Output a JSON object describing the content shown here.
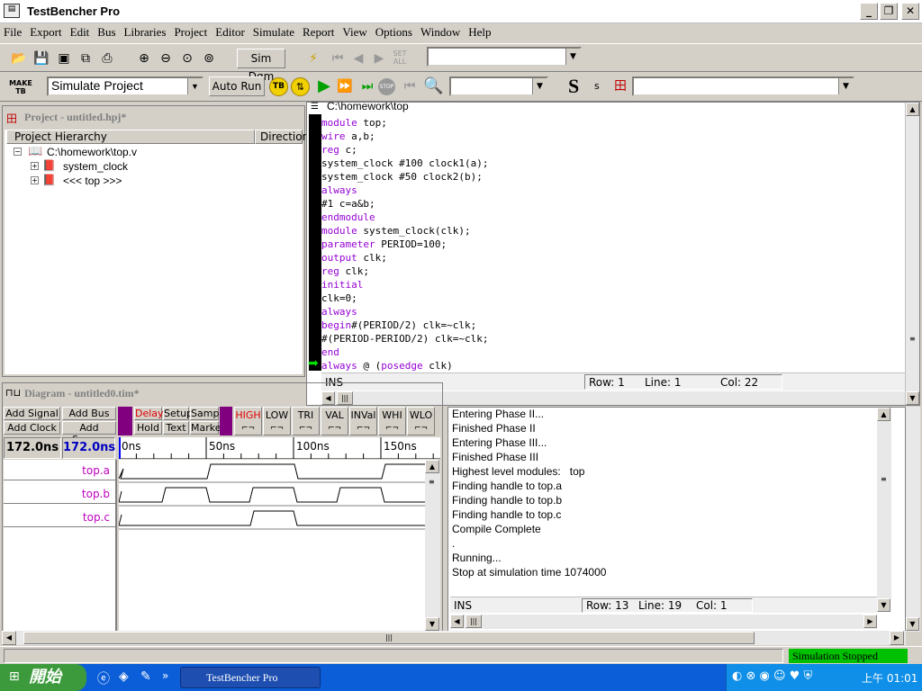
{
  "app": {
    "title": "TestBencher Pro"
  },
  "menu": [
    "File",
    "Export",
    "Edit",
    "Bus",
    "Libraries",
    "Project",
    "Editor",
    "Simulate",
    "Report",
    "View",
    "Options",
    "Window",
    "Help"
  ],
  "toolbar": {
    "sim_dgm": "Sim Dgm",
    "set_all": "SET ALL",
    "make_tb": "MAKE TB",
    "simulate_project": "Simulate Project",
    "auto_run": "Auto Run",
    "tb": "TB",
    "stop": "STOP",
    "s_big": "S",
    "s_small": "s"
  },
  "project": {
    "title": "Project - untitled.hpj*",
    "col_hierarchy": "Project Hierarchy",
    "col_direction": "Direction",
    "root": "C:\\homework\\top.v",
    "children": [
      "system_clock",
      "<<< top >>>"
    ]
  },
  "editor": {
    "title": "C:\\homework\\top",
    "lines": [
      "module top;",
      "wire a,b;",
      "reg c;",
      "system_clock #100 clock1(a);",
      "system_clock #50 clock2(b);",
      "always",
      "#1 c=a&b;",
      "endmodule",
      "module system_clock(clk);",
      "parameter PERIOD=100;",
      "output clk;",
      "reg clk;",
      "initial",
      "clk=0;",
      "always",
      "begin#(PERIOD/2) clk=~clk;",
      "#(PERIOD-PERIOD/2) clk=~clk;",
      "end",
      "always @ (posedge clk)"
    ],
    "keywords": [
      "module",
      "wire",
      "reg",
      "always",
      "endmodule",
      "parameter",
      "output",
      "initial",
      "begin",
      "end",
      "posedge"
    ],
    "status": {
      "mode": "INS",
      "row": "Row: 1",
      "line": "Line: 1",
      "col": "Col: 22"
    }
  },
  "diagram": {
    "title": "Diagram - untitled0.tim*",
    "buttons": {
      "add_signal": "Add Signal",
      "add_bus": "Add Bus",
      "add_clock": "Add Clock",
      "add_spacer": "Add Spacer",
      "delay": "Delay",
      "setup": "Setup",
      "sample": "Sample",
      "hold": "Hold",
      "text": "Text",
      "marker": "Marker"
    },
    "states": [
      "HIGH",
      "LOW",
      "TRI",
      "VAL",
      "INVal",
      "WHI",
      "WLO"
    ],
    "time_left": "172.0ns",
    "time_right": "172.0ns",
    "ticks": [
      "0ns",
      "50ns",
      "100ns",
      "150ns"
    ],
    "signals": [
      "top.a",
      "top.b",
      "top.c"
    ]
  },
  "log": {
    "lines": [
      "Entering Phase II...",
      "Finished Phase II",
      "Entering Phase III...",
      "Finished Phase III",
      "Highest level modules:   top",
      "Finding handle to top.a",
      "Finding handle to top.b",
      "Finding handle to top.c",
      "Compile Complete",
      ".",
      "Running...",
      "Stop at simulation time 1074000"
    ],
    "status": {
      "mode": "INS",
      "row": "Row: 13",
      "line": "Line: 19",
      "col": "Col: 1"
    }
  },
  "statusbar": {
    "sim_status": "Simulation Stopped"
  },
  "taskbar": {
    "start": "開始",
    "task": "TestBencher Pro",
    "clock": "上午 01:01"
  },
  "colors": {
    "keyword": "#9400d3",
    "signal": "#c000c0",
    "status_green": "#00c000",
    "taskbar": "#0b5ed7"
  }
}
